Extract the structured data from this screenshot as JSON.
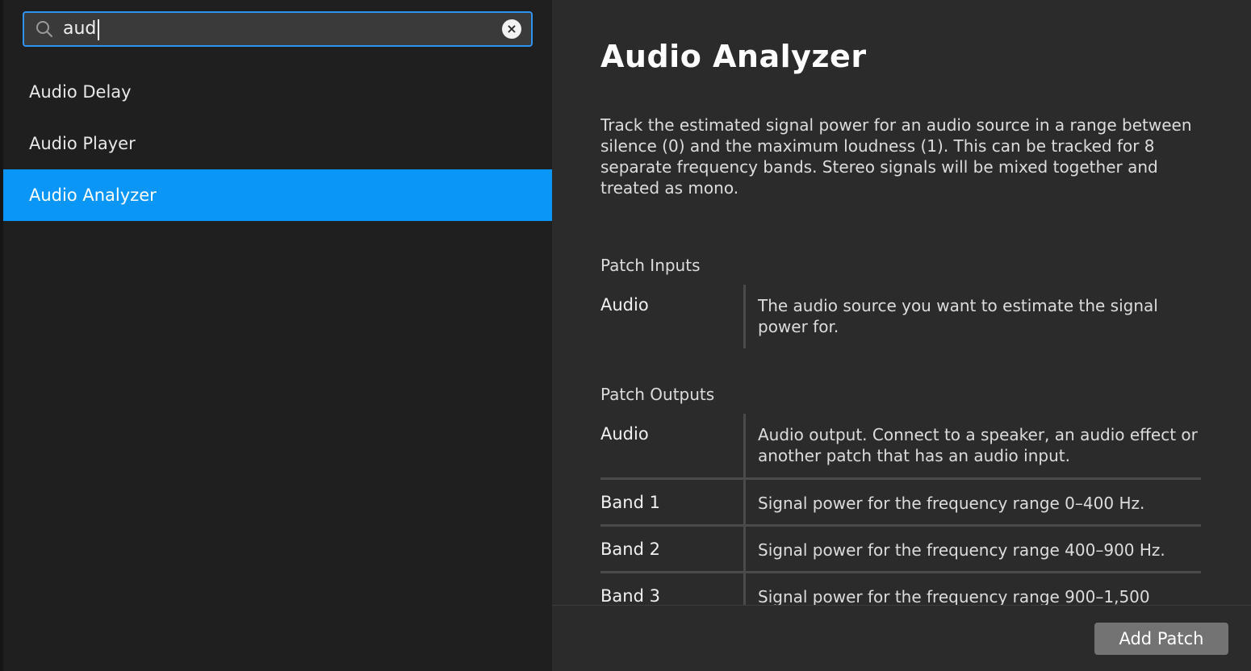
{
  "search": {
    "value": "aud",
    "clear_label": "×"
  },
  "results": [
    {
      "label": "Audio Delay",
      "selected": false
    },
    {
      "label": "Audio Player",
      "selected": false
    },
    {
      "label": "Audio Analyzer",
      "selected": true
    }
  ],
  "detail": {
    "title": "Audio Analyzer",
    "description": "Track the estimated signal power for an audio source in a range between silence (0) and the maximum loudness (1). This can be tracked for 8 separate frequency bands. Stereo signals will be mixed together and treated as mono.",
    "inputs_heading": "Patch Inputs",
    "inputs": [
      {
        "name": "Audio",
        "desc": "The audio source you want to estimate the signal power for."
      }
    ],
    "outputs_heading": "Patch Outputs",
    "outputs": [
      {
        "name": "Audio",
        "desc": "Audio output. Connect to a speaker, an audio effect or another patch that has an audio input."
      },
      {
        "name": "Band 1",
        "desc": "Signal power for the frequency range 0–400 Hz."
      },
      {
        "name": "Band 2",
        "desc": "Signal power for the frequency range 400–900 Hz."
      },
      {
        "name": "Band 3",
        "desc": "Signal power for the frequency range 900–1,500"
      }
    ]
  },
  "footer": {
    "add_patch_label": "Add Patch"
  },
  "colors": {
    "accent": "#0a96f6",
    "search_border": "#2e94f0",
    "panel_left": "#1f1f1f",
    "panel_right": "#2b2b2b"
  }
}
